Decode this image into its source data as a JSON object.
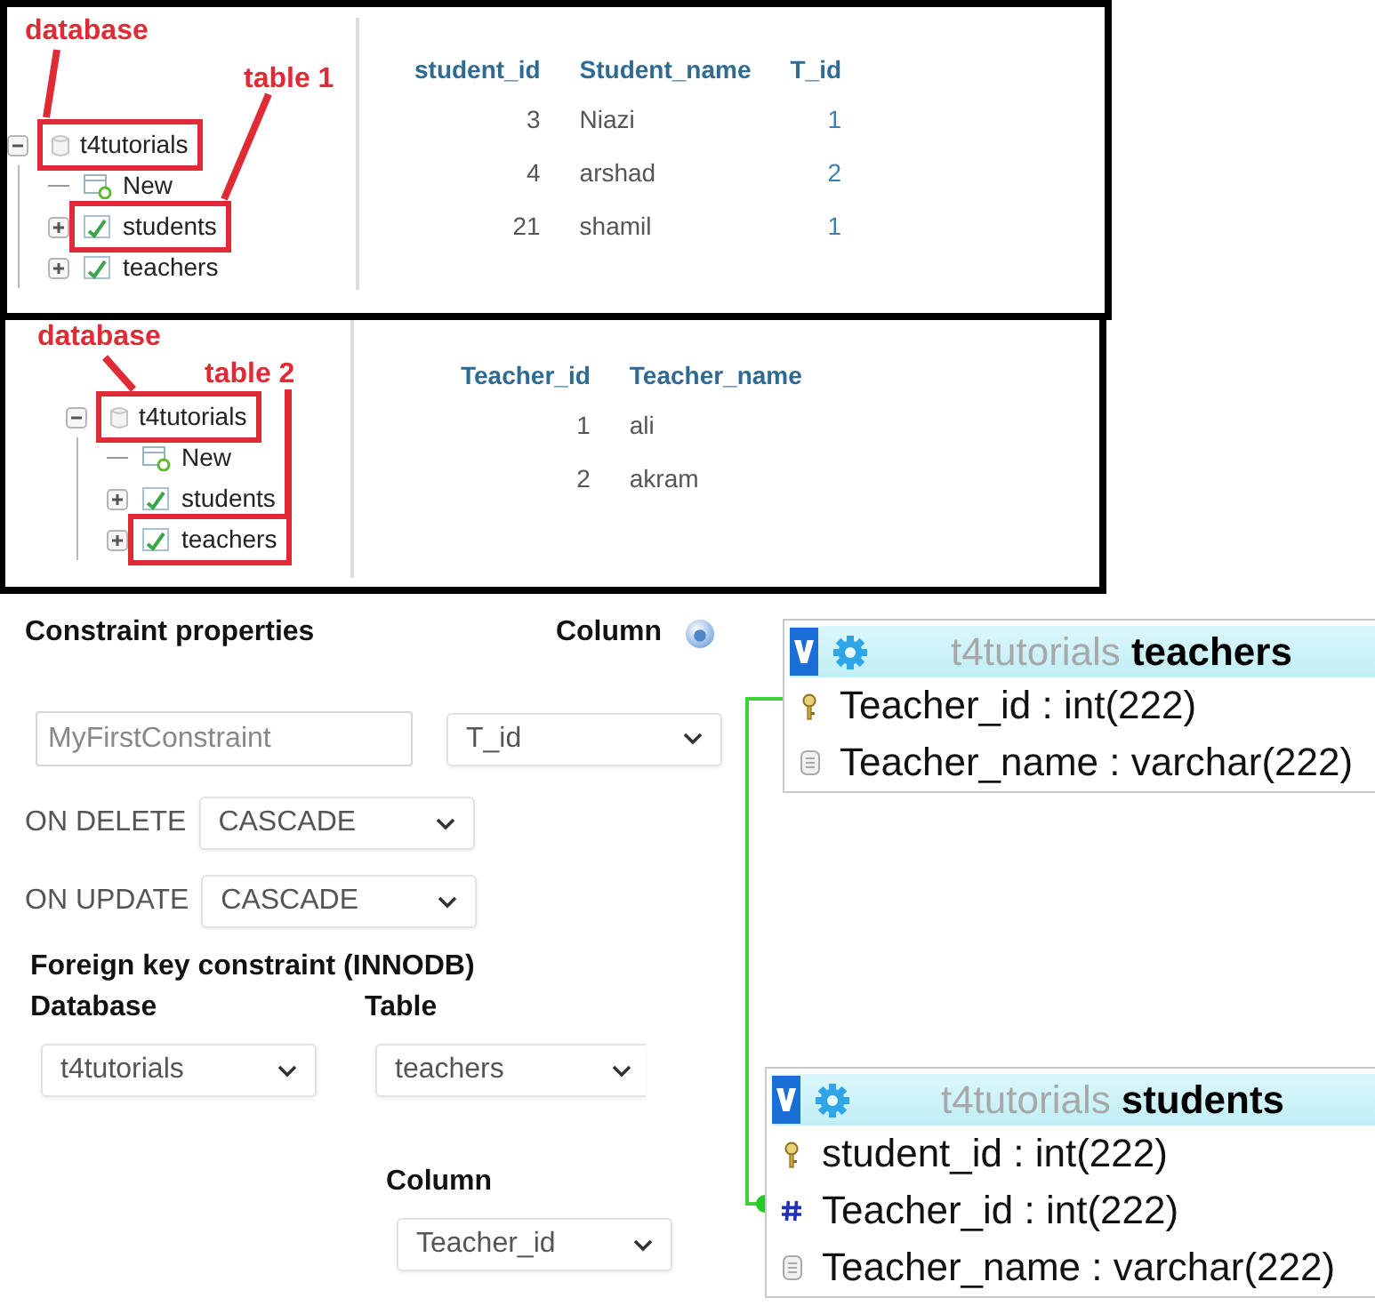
{
  "panels": [
    {
      "callouts": [
        {
          "text": "database"
        },
        {
          "text": "table 1"
        }
      ],
      "tree": {
        "name": "t4tutorials",
        "kind": "database",
        "expanded": true,
        "highlighted": true,
        "children": [
          {
            "name": "New",
            "kind": "new",
            "highlighted": false
          },
          {
            "name": "students",
            "kind": "table",
            "expanded": false,
            "highlighted": true
          },
          {
            "name": "teachers",
            "kind": "table",
            "expanded": false,
            "highlighted": false
          }
        ]
      },
      "table": {
        "columns": [
          {
            "label": "student_id",
            "kind": "number"
          },
          {
            "label": "Student_name",
            "kind": "text"
          },
          {
            "label": "T_id",
            "kind": "link"
          }
        ],
        "rows": [
          [
            "3",
            "Niazi",
            "1"
          ],
          [
            "4",
            "arshad",
            "2"
          ],
          [
            "21",
            "shamil",
            "1"
          ]
        ]
      }
    },
    {
      "callouts": [
        {
          "text": "database"
        },
        {
          "text": "table 2"
        }
      ],
      "tree": {
        "name": "t4tutorials",
        "kind": "database",
        "expanded": true,
        "highlighted": true,
        "children": [
          {
            "name": "New",
            "kind": "new",
            "highlighted": false
          },
          {
            "name": "students",
            "kind": "table",
            "expanded": false,
            "highlighted": false
          },
          {
            "name": "teachers",
            "kind": "table",
            "expanded": false,
            "highlighted": true
          }
        ]
      },
      "table": {
        "columns": [
          {
            "label": "Teacher_id",
            "kind": "number"
          },
          {
            "label": "Teacher_name",
            "kind": "text"
          }
        ],
        "rows": [
          [
            "1",
            "ali"
          ],
          [
            "2",
            "akram"
          ]
        ]
      }
    }
  ],
  "constraint_form": {
    "title": "Constraint properties",
    "column_heading": "Column",
    "name_field": {
      "value": "MyFirstConstraint"
    },
    "column_select": {
      "value": "T_id"
    },
    "on_delete": {
      "label": "ON DELETE",
      "value": "CASCADE"
    },
    "on_update": {
      "label": "ON UPDATE",
      "value": "CASCADE"
    },
    "foreign_key_heading": "Foreign key constraint (INNODB)",
    "database": {
      "label": "Database",
      "value": "t4tutorials"
    },
    "table": {
      "label": "Table",
      "value": "teachers"
    },
    "column": {
      "label": "Column",
      "value": "Teacher_id"
    }
  },
  "designer": {
    "tables": [
      {
        "database": "t4tutorials",
        "name": "teachers",
        "columns": [
          {
            "label": "Teacher_id : int(222)",
            "kind": "primary"
          },
          {
            "label": "Teacher_name : varchar(222)",
            "kind": "plain"
          }
        ]
      },
      {
        "database": "t4tutorials",
        "name": "students",
        "columns": [
          {
            "label": "student_id : int(222)",
            "kind": "primary"
          },
          {
            "label": "Teacher_id : int(222)",
            "kind": "foreign"
          },
          {
            "label": "Teacher_name : varchar(222)",
            "kind": "plain"
          }
        ]
      }
    ]
  }
}
